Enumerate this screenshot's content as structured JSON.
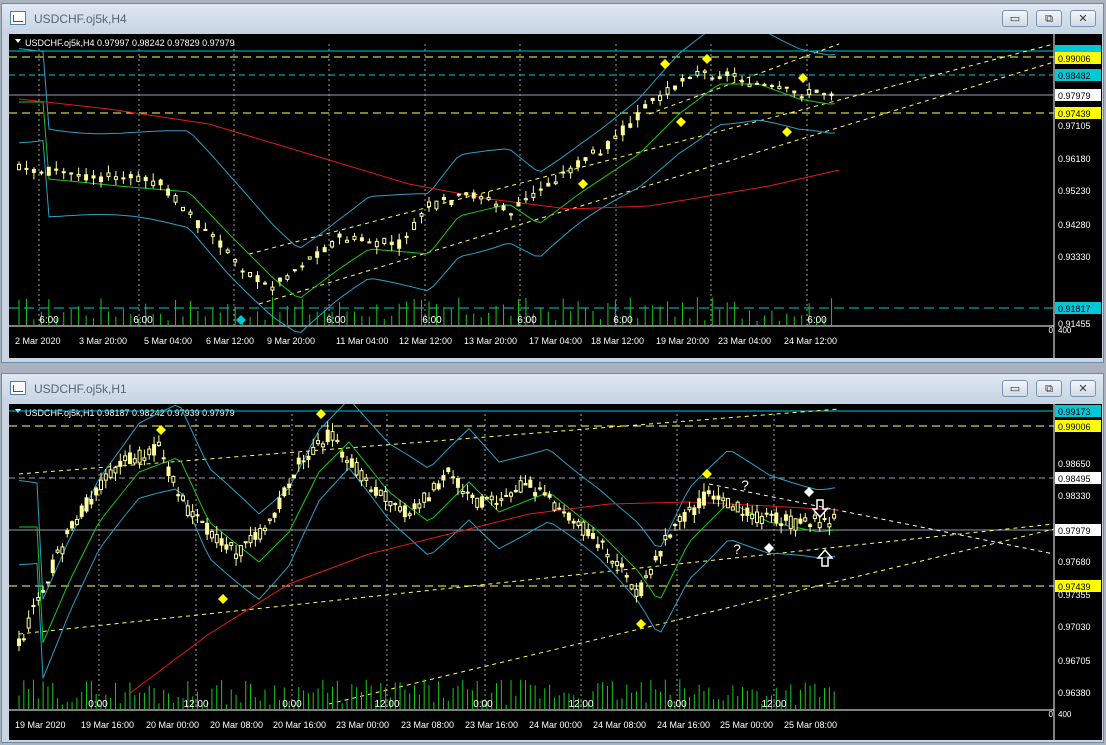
{
  "windows": [
    {
      "title": "USDCHF.oj5k,H4",
      "header": "USDCHF.oj5k,H4  0.97997 0.98242 0.97829 0.97979",
      "price_labels": [
        {
          "text": "0.99172",
          "color": "#00c8d8",
          "fill": "#00c8d8"
        },
        {
          "text": "0.99006",
          "color": "#000000",
          "fill": "#ffff00"
        },
        {
          "text": "0.98482",
          "color": "#000000",
          "fill": "#00c8d8"
        },
        {
          "text": "0.97979",
          "color": "#000000",
          "fill": "#ffffff"
        },
        {
          "text": "0.97439",
          "color": "#000000",
          "fill": "#ffff00"
        },
        {
          "text": "0.97105",
          "color": "#ffffff",
          "fill": ""
        },
        {
          "text": "0.96180",
          "color": "#ffffff",
          "fill": ""
        },
        {
          "text": "0.95230",
          "color": "#ffffff",
          "fill": ""
        },
        {
          "text": "0.94280",
          "color": "#ffffff",
          "fill": ""
        },
        {
          "text": "0.93330",
          "color": "#ffffff",
          "fill": ""
        },
        {
          "text": "0.91817",
          "color": "#000000",
          "fill": "#00c8d8"
        },
        {
          "text": "0.91455",
          "color": "#ffffff",
          "fill": ""
        }
      ],
      "scale_zero": "0",
      "scale_end": "400",
      "session_labels": [
        "6:00",
        "6:00",
        "6:00",
        "6:00",
        "6:00",
        "6:00",
        "6:00"
      ],
      "date_labels": [
        "2 Mar 2020",
        "3 Mar 20:00",
        "5 Mar 04:00",
        "6 Mar 12:00",
        "9 Mar 20:00",
        "11 Mar 04:00",
        "12 Mar 12:00",
        "13 Mar 20:00",
        "17 Mar 04:00",
        "18 Mar 12:00",
        "19 Mar 20:00",
        "23 Mar 04:00",
        "24 Mar 12:00"
      ]
    },
    {
      "title": "USDCHF.oj5k,H1",
      "header": "USDCHF.oj5k,H1  0.98187 0.98242 0.97939 0.97979",
      "price_labels": [
        {
          "text": "0.99173",
          "color": "#000000",
          "fill": "#00c8d8"
        },
        {
          "text": "0.99006",
          "color": "#000000",
          "fill": "#ffff00"
        },
        {
          "text": "0.98650",
          "color": "#ffffff",
          "fill": ""
        },
        {
          "text": "0.98495",
          "color": "#000000",
          "fill": "#ffffff"
        },
        {
          "text": "0.98330",
          "color": "#ffffff",
          "fill": ""
        },
        {
          "text": "0.97979",
          "color": "#000000",
          "fill": "#ffffff"
        },
        {
          "text": "0.97680",
          "color": "#ffffff",
          "fill": ""
        },
        {
          "text": "0.97439",
          "color": "#000000",
          "fill": "#ffff00"
        },
        {
          "text": "0.97355",
          "color": "#ffffff",
          "fill": ""
        },
        {
          "text": "0.97030",
          "color": "#ffffff",
          "fill": ""
        },
        {
          "text": "0.96705",
          "color": "#ffffff",
          "fill": ""
        },
        {
          "text": "0.96380",
          "color": "#ffffff",
          "fill": ""
        }
      ],
      "scale_zero": "0",
      "scale_end": "400",
      "session_labels": [
        "0:00",
        "12:00",
        "0:00",
        "12:00",
        "0:00",
        "12:00",
        "0:00",
        "12:00"
      ],
      "date_labels": [
        "19 Mar 2020",
        "19 Mar 16:00",
        "20 Mar 00:00",
        "20 Mar 08:00",
        "20 Mar 16:00",
        "23 Mar 00:00",
        "23 Mar 08:00",
        "23 Mar 16:00",
        "24 Mar 00:00",
        "24 Mar 08:00",
        "24 Mar 16:00",
        "25 Mar 00:00",
        "25 Mar 08:00"
      ],
      "annotations": [
        "?",
        "?"
      ]
    }
  ],
  "buttons": {
    "minimize": "▭",
    "restore": "⧉",
    "close": "✕"
  },
  "colors": {
    "candle_bull": "#ffff9f",
    "candle_bear": "#ffff9f",
    "ma_fast": "#19c819",
    "ma_slow": "#e01a1a",
    "bollinger": "#2aa0c8",
    "volume": "#19c819",
    "fractal": "#ffff00",
    "trendline": "#ffff66",
    "grid": "#9aa0a6"
  }
}
